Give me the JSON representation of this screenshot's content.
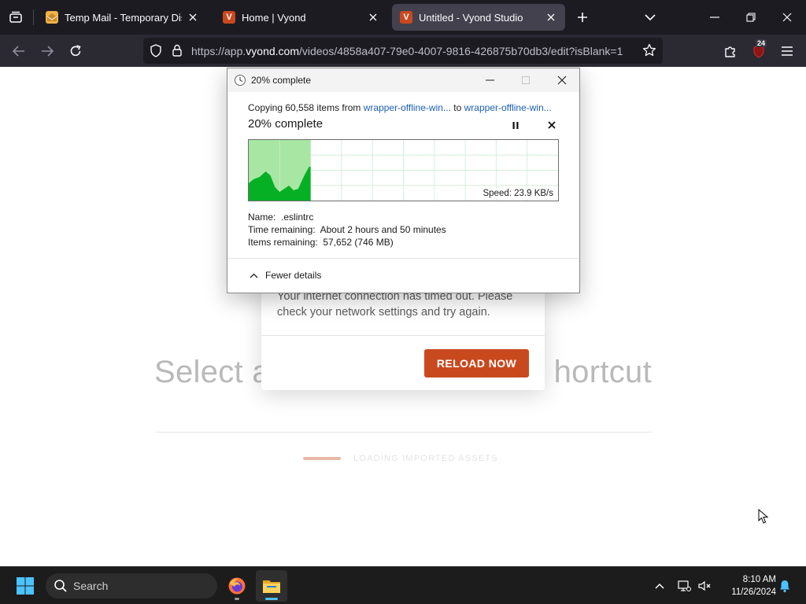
{
  "browser": {
    "tabs": [
      {
        "title": "Temp Mail - Temporary Dispos",
        "active": false
      },
      {
        "title": "Home | Vyond",
        "active": false
      },
      {
        "title": "Untitled - Vyond Studio",
        "active": true
      }
    ],
    "url_prefix": "https://app.",
    "url_domain": "vyond.com",
    "url_path": "/videos/4858a407-79e0-4007-9816-426875b70db3/edit?isBlank=1",
    "extension_badge": "24"
  },
  "page": {
    "bg_title_left": "Select a",
    "bg_title_right": "hortcut",
    "loading_text": "LOADING IMPORTED ASSETS",
    "timeout_message": "Your internet connection has timed out. Please check your network settings and try again.",
    "reload_label": "RELOAD NOW"
  },
  "dialog": {
    "title": "20% complete",
    "copy_prefix": "Copying 60,558 items from ",
    "source": "wrapper-offline-win...",
    "copy_to": " to ",
    "destination": "wrapper-offline-win...",
    "heading": "20% complete",
    "speed": "Speed: 23.9 KB/s",
    "progress_fraction": 0.2,
    "name_label": "Name:",
    "name_value": ".eslintrc",
    "time_label": "Time remaining:",
    "time_value": "About 2 hours and 50 minutes",
    "items_label": "Items remaining:",
    "items_value": "57,652 (746 MB)",
    "fewer_details": "Fewer details"
  },
  "taskbar": {
    "search_placeholder": "Search",
    "time": "8:10 AM",
    "date": "11/26/2024"
  },
  "colors": {
    "accent_orange": "#c9491f",
    "link_blue": "#1c5fb5",
    "graph_green": "#06b025"
  }
}
